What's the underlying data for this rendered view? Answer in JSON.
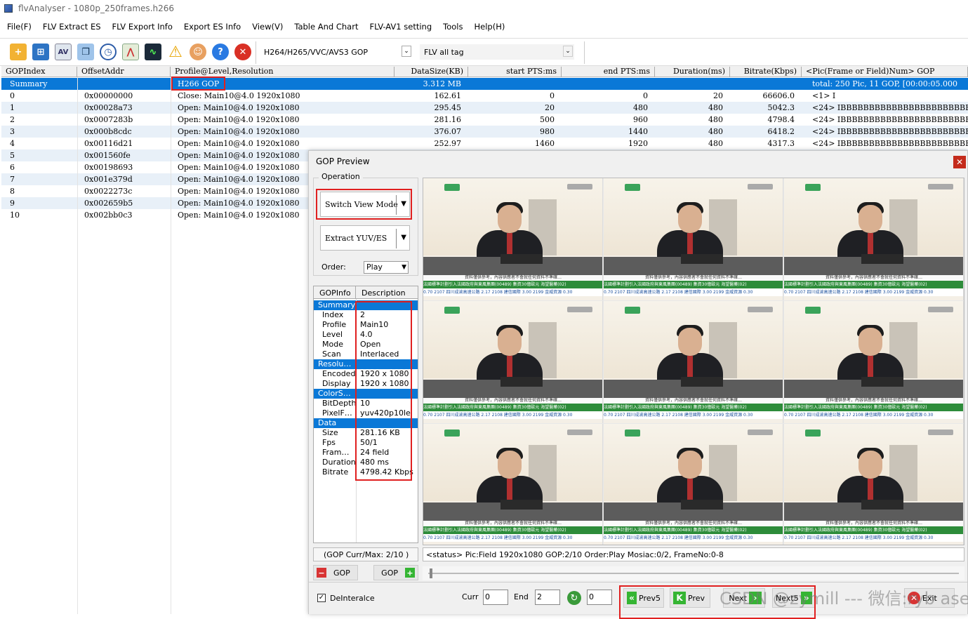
{
  "window": {
    "title": "flvAnalyser - 1080p_250frames.h266"
  },
  "menu": [
    "File(F)",
    "FLV Extract ES",
    "FLV Export Info",
    "Export ES Info",
    "View(V)",
    "Table And Chart",
    "FLV-AV1 setting",
    "Tools",
    "Help(H)"
  ],
  "toolbar": {
    "gop_mode_value": "H264/H265/VVC/AVS3 GOP",
    "flv_tag_value": "FLV all tag",
    "icons": [
      "open-folder-icon",
      "network-icon",
      "av-icon",
      "copy-icon",
      "clock-icon",
      "chart-icon",
      "waveform-icon",
      "warning-icon",
      "user-icon",
      "help-icon",
      "close-icon"
    ]
  },
  "table": {
    "columns": [
      "GOPIndex",
      "OffsetAddr",
      "Profile@Level,Resolution",
      "DataSize(KB)",
      "start PTS:ms",
      "end PTS:ms",
      "Duration(ms)",
      "Bitrate(Kbps)",
      "<Pic(Frame or Field)Num> GOP"
    ],
    "summary": [
      "Summary",
      "",
      "H266 GOP",
      "3.312 MB",
      "",
      "",
      "",
      "",
      "total: 250 Pic, 11 GOP, [00:00:05.000"
    ],
    "rows": [
      [
        "0",
        "0x00000000",
        "Close: Main10@4.0  1920x1080",
        "162.61",
        "0",
        "0",
        "20",
        "66606.0",
        "<1> I"
      ],
      [
        "1",
        "0x00028a73",
        "Open: Main10@4.0  1920x1080",
        "295.45",
        "20",
        "480",
        "480",
        "5042.3",
        "<24> IBBBBBBBBBBBBBBBBBBBBBBB"
      ],
      [
        "2",
        "0x0007283b",
        "Open: Main10@4.0  1920x1080",
        "281.16",
        "500",
        "960",
        "480",
        "4798.4",
        "<24> IBBBBBBBBBBBBBBBBBBBBBBB"
      ],
      [
        "3",
        "0x000b8cdc",
        "Open: Main10@4.0  1920x1080",
        "376.07",
        "980",
        "1440",
        "480",
        "6418.2",
        "<24> IBBBBBBBBBBBBBBBBBBBBBBB"
      ],
      [
        "4",
        "0x00116d21",
        "Open: Main10@4.0  1920x1080",
        "252.97",
        "1460",
        "1920",
        "480",
        "4317.3",
        "<24> IBBBBBBBBBBBBBBBBBBBBBBB"
      ],
      [
        "5",
        "0x001560fe",
        "Open: Main10@4.0  1920x1080",
        "",
        "",
        "",
        "",
        "",
        ""
      ],
      [
        "6",
        "0x00198693",
        "Open: Main10@4.0  1920x1080",
        "",
        "",
        "",
        "",
        "",
        ""
      ],
      [
        "7",
        "0x001e379d",
        "Open: Main10@4.0  1920x1080",
        "",
        "",
        "",
        "",
        "",
        ""
      ],
      [
        "8",
        "0x0022273c",
        "Open: Main10@4.0  1920x1080",
        "",
        "",
        "",
        "",
        "",
        ""
      ],
      [
        "9",
        "0x002659b5",
        "Open: Main10@4.0  1920x1080",
        "",
        "",
        "",
        "",
        "",
        ""
      ],
      [
        "10",
        "0x002bb0c3",
        "Open: Main10@4.0  1920x1080",
        "",
        "",
        "",
        "",
        "",
        ""
      ]
    ]
  },
  "dialog": {
    "title": "GOP Preview",
    "operation_label": "Operation",
    "switch_view_mode": "Switch View Mode",
    "extract_yuv": "Extract YUV/ES",
    "order_label": "Order:",
    "order_value": "Play",
    "info_headers": [
      "GOPInfo",
      "Description"
    ],
    "info_rows": [
      {
        "k": "Summary",
        "v": "",
        "hdr": true
      },
      {
        "k": "Index",
        "v": "2"
      },
      {
        "k": "Profile",
        "v": "Main10"
      },
      {
        "k": "Level",
        "v": "4.0"
      },
      {
        "k": "Mode",
        "v": "Open"
      },
      {
        "k": "Scan",
        "v": "Interlaced"
      },
      {
        "k": "Resolu…",
        "v": "",
        "hdr": true
      },
      {
        "k": "Encoded",
        "v": "1920 x 1080"
      },
      {
        "k": "Display",
        "v": "1920 x 1080"
      },
      {
        "k": "ColorS…",
        "v": "",
        "hdr": true
      },
      {
        "k": "BitDepth",
        "v": "10"
      },
      {
        "k": "PixelF…",
        "v": "yuv420p10le"
      },
      {
        "k": "Data",
        "v": "",
        "hdr": true
      },
      {
        "k": "Size",
        "v": "281.16 KB"
      },
      {
        "k": "Fps",
        "v": "50/1"
      },
      {
        "k": "Fram…",
        "v": "24 field"
      },
      {
        "k": "Duration",
        "v": "480 ms"
      },
      {
        "k": "Bitrate",
        "v": "4798.42 Kbps"
      }
    ],
    "frame_ticker_top": "資料僅供參考，內容供應者不會就任何資料不準確…",
    "frame_ticker_mid": "法國標準計劃引入法國政府與東風集團(00489)  集資30億歐元  海望醫藥(02)",
    "frame_ticker_bot": "0.70  2107 四川成渝高速公路 2.17  2108 建信國際 3.00  2199 金威資源 0.30",
    "gop_curmax": "(GOP Curr/Max:  2/10 )",
    "status": "<status> Pic:Field   1920x1080  GOP:2/10 Order:Play Mosiac:0/2, FrameNo:0-8",
    "gop_prev_label": "GOP",
    "gop_next_label": "GOP",
    "deinterlace_label": "DeInteralce",
    "curr_label": "Curr",
    "curr_value": "0",
    "end_label": "End",
    "end_value": "2",
    "step_value": "0",
    "prev5": "Prev5",
    "prev": "Prev",
    "next": "Next",
    "next5": "Next5",
    "exit": "Exit"
  },
  "watermark": "CSDN @zymill --- 微信:ryb ase"
}
